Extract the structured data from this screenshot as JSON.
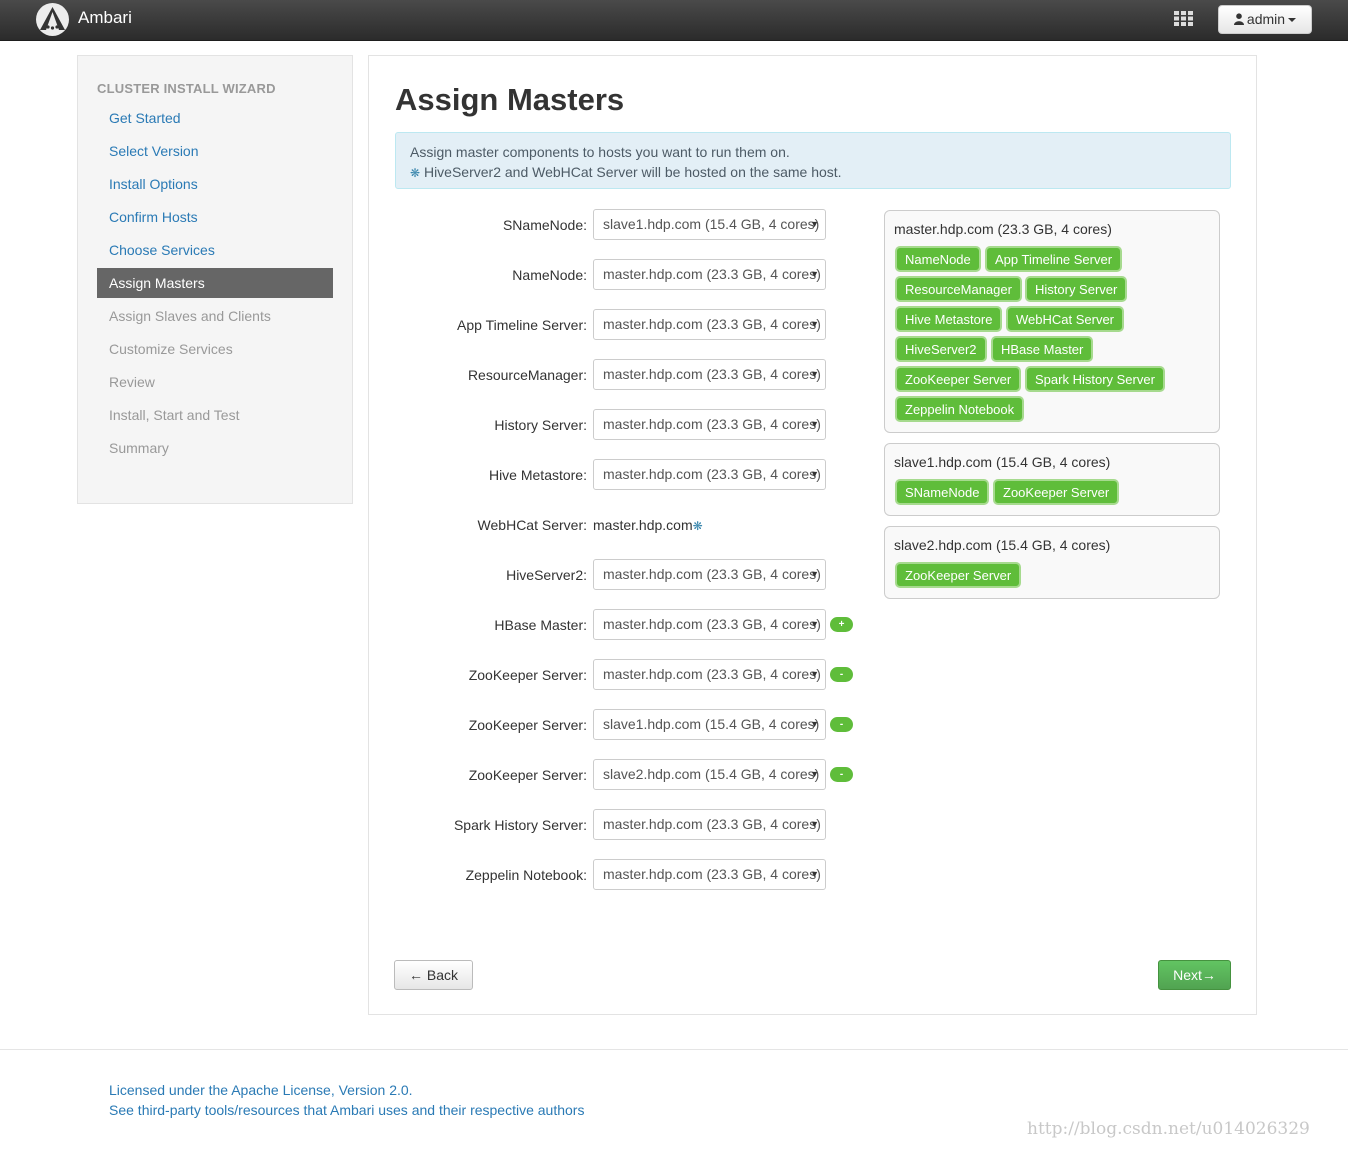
{
  "app": {
    "brand": "Ambari",
    "user": "admin"
  },
  "sidebar": {
    "title": "CLUSTER INSTALL WIZARD",
    "steps": [
      {
        "label": "Get Started",
        "state": "done"
      },
      {
        "label": "Select Version",
        "state": "done"
      },
      {
        "label": "Install Options",
        "state": "done"
      },
      {
        "label": "Confirm Hosts",
        "state": "done"
      },
      {
        "label": "Choose Services",
        "state": "done"
      },
      {
        "label": "Assign Masters",
        "state": "active"
      },
      {
        "label": "Assign Slaves and Clients",
        "state": "todo"
      },
      {
        "label": "Customize Services",
        "state": "todo"
      },
      {
        "label": "Review",
        "state": "todo"
      },
      {
        "label": "Install, Start and Test",
        "state": "todo"
      },
      {
        "label": "Summary",
        "state": "todo"
      }
    ]
  },
  "main": {
    "title": "Assign Masters",
    "alert_line1": "Assign master components to hosts you want to run them on.",
    "alert_star": "❋",
    "alert_line2": " HiveServer2 and WebHCat Server will be hosted on the same host.",
    "assignments": [
      {
        "label": "SNameNode:",
        "value": "slave1.hdp.com (15.4 GB, 4 cores)",
        "kind": "select"
      },
      {
        "label": "NameNode:",
        "value": "master.hdp.com (23.3 GB, 4 cores)",
        "kind": "select"
      },
      {
        "label": "App Timeline Server:",
        "value": "master.hdp.com (23.3 GB, 4 cores)",
        "kind": "select"
      },
      {
        "label": "ResourceManager:",
        "value": "master.hdp.com (23.3 GB, 4 cores)",
        "kind": "select"
      },
      {
        "label": "History Server:",
        "value": "master.hdp.com (23.3 GB, 4 cores)",
        "kind": "select"
      },
      {
        "label": "Hive Metastore:",
        "value": "master.hdp.com (23.3 GB, 4 cores)",
        "kind": "select"
      },
      {
        "label": "WebHCat Server:",
        "value": "master.hdp.com",
        "kind": "static"
      },
      {
        "label": "HiveServer2:",
        "value": "master.hdp.com (23.3 GB, 4 cores)",
        "kind": "select"
      },
      {
        "label": "HBase Master:",
        "value": "master.hdp.com (23.3 GB, 4 cores)",
        "kind": "select",
        "action": "+"
      },
      {
        "label": "ZooKeeper Server:",
        "value": "master.hdp.com (23.3 GB, 4 cores)",
        "kind": "select",
        "action": "-"
      },
      {
        "label": "ZooKeeper Server:",
        "value": "slave1.hdp.com (15.4 GB, 4 cores)",
        "kind": "select",
        "action": "-"
      },
      {
        "label": "ZooKeeper Server:",
        "value": "slave2.hdp.com (15.4 GB, 4 cores)",
        "kind": "select",
        "action": "-"
      },
      {
        "label": "Spark History Server:",
        "value": "master.hdp.com (23.3 GB, 4 cores)",
        "kind": "select"
      },
      {
        "label": "Zeppelin Notebook:",
        "value": "master.hdp.com (23.3 GB, 4 cores)",
        "kind": "select"
      }
    ],
    "hosts": [
      {
        "name": "master.hdp.com (23.3 GB, 4 cores)",
        "components": [
          "NameNode",
          "App Timeline Server",
          "ResourceManager",
          "History Server",
          "Hive Metastore",
          "WebHCat Server",
          "HiveServer2",
          "HBase Master",
          "ZooKeeper Server",
          "Spark History Server",
          "Zeppelin Notebook"
        ]
      },
      {
        "name": "slave1.hdp.com (15.4 GB, 4 cores)",
        "components": [
          "SNameNode",
          "ZooKeeper Server"
        ]
      },
      {
        "name": "slave2.hdp.com (15.4 GB, 4 cores)",
        "components": [
          "ZooKeeper Server"
        ]
      }
    ],
    "back_label": "← Back",
    "next_label": "Next→"
  },
  "footer": {
    "license": "Licensed under the Apache License, Version 2.0.",
    "thirdparty": "See third-party tools/resources that Ambari uses and their respective authors"
  },
  "watermark": "http://blog.csdn.net/u014026329"
}
